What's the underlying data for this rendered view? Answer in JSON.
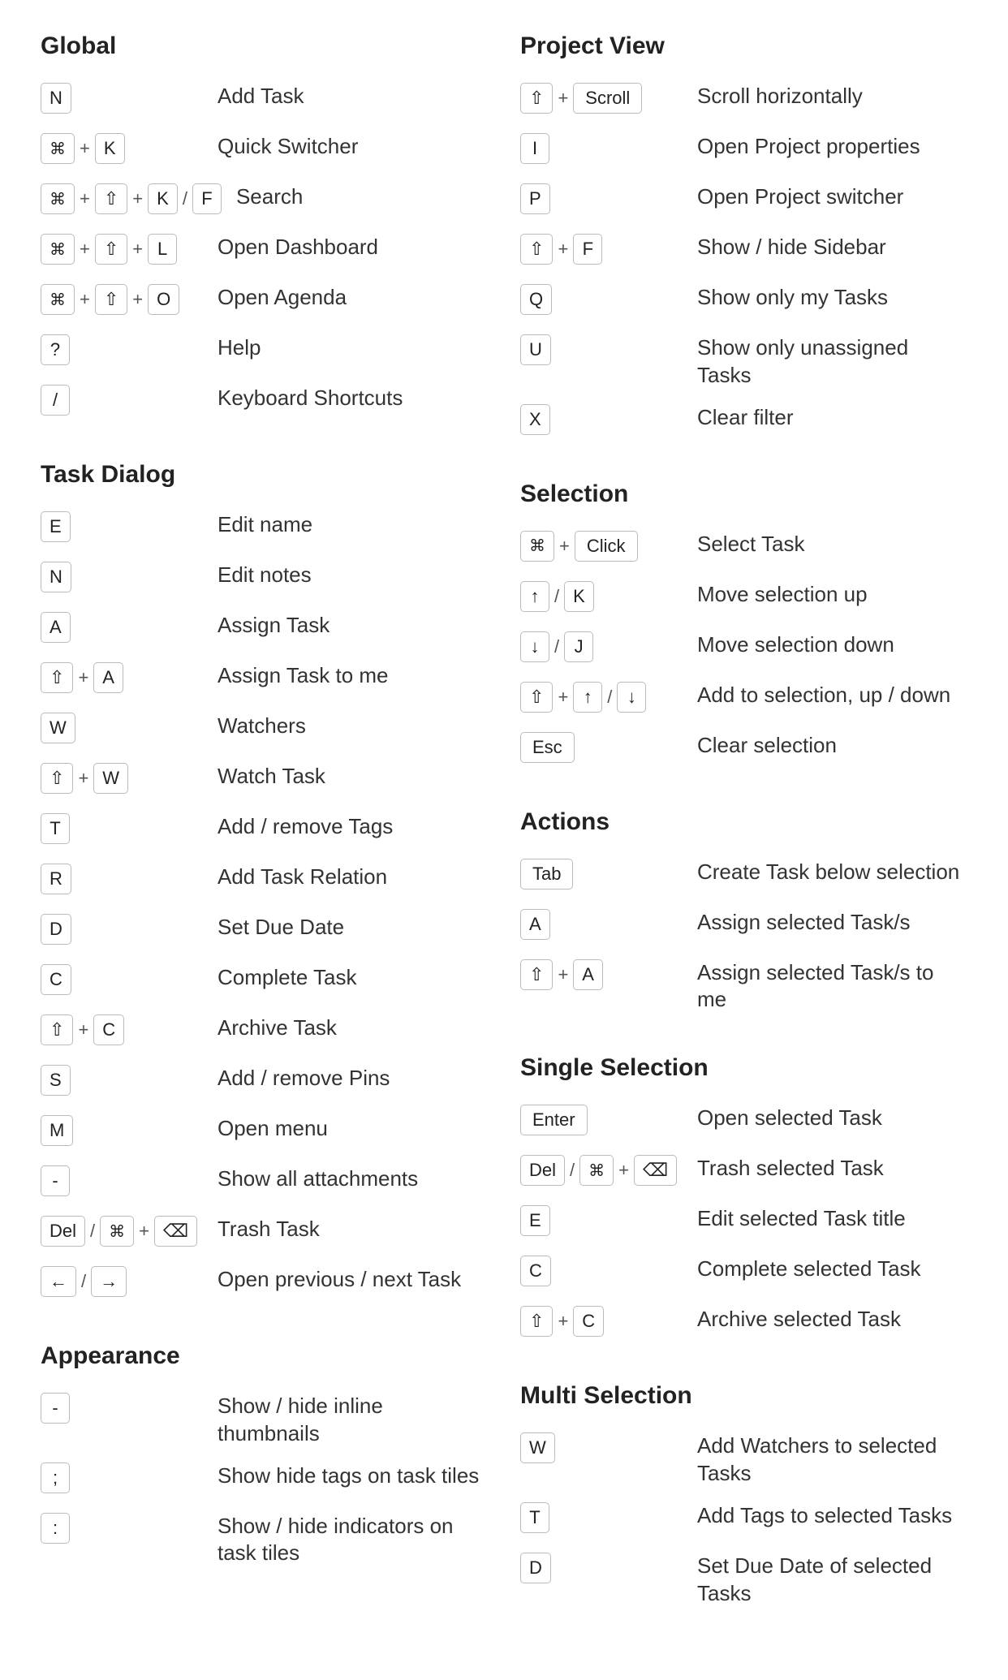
{
  "sections": {
    "global": {
      "title": "Global",
      "shortcuts": [
        {
          "keys": [
            {
              "type": "key",
              "label": "N"
            }
          ],
          "action": "Add Task"
        },
        {
          "keys": [
            {
              "type": "key",
              "label": "⌘",
              "cls": "cmd"
            },
            {
              "type": "sep",
              "label": "+"
            },
            {
              "type": "key",
              "label": "K"
            }
          ],
          "action": "Quick Switcher"
        },
        {
          "keys": [
            {
              "type": "key",
              "label": "⌘",
              "cls": "cmd"
            },
            {
              "type": "sep",
              "label": "+"
            },
            {
              "type": "key",
              "label": "⇧"
            },
            {
              "type": "sep",
              "label": "+"
            },
            {
              "type": "key",
              "label": "K"
            },
            {
              "type": "sep",
              "label": "/"
            },
            {
              "type": "key",
              "label": "F"
            }
          ],
          "action": "Search"
        },
        {
          "keys": [
            {
              "type": "key",
              "label": "⌘",
              "cls": "cmd"
            },
            {
              "type": "sep",
              "label": "+"
            },
            {
              "type": "key",
              "label": "⇧"
            },
            {
              "type": "sep",
              "label": "+"
            },
            {
              "type": "key",
              "label": "L"
            }
          ],
          "action": "Open Dashboard"
        },
        {
          "keys": [
            {
              "type": "key",
              "label": "⌘",
              "cls": "cmd"
            },
            {
              "type": "sep",
              "label": "+"
            },
            {
              "type": "key",
              "label": "⇧"
            },
            {
              "type": "sep",
              "label": "+"
            },
            {
              "type": "key",
              "label": "O"
            }
          ],
          "action": "Open Agenda"
        },
        {
          "keys": [
            {
              "type": "key",
              "label": "?"
            }
          ],
          "action": "Help"
        },
        {
          "keys": [
            {
              "type": "key",
              "label": "/"
            }
          ],
          "action": "Keyboard Shortcuts"
        }
      ]
    },
    "taskDialog": {
      "title": "Task Dialog",
      "shortcuts": [
        {
          "keys": [
            {
              "type": "key",
              "label": "E"
            }
          ],
          "action": "Edit name"
        },
        {
          "keys": [
            {
              "type": "key",
              "label": "N"
            }
          ],
          "action": "Edit notes"
        },
        {
          "keys": [
            {
              "type": "key",
              "label": "A"
            }
          ],
          "action": "Assign Task"
        },
        {
          "keys": [
            {
              "type": "key",
              "label": "⇧"
            },
            {
              "type": "sep",
              "label": "+"
            },
            {
              "type": "key",
              "label": "A"
            }
          ],
          "action": "Assign Task to me"
        },
        {
          "keys": [
            {
              "type": "key",
              "label": "W"
            }
          ],
          "action": "Watchers"
        },
        {
          "keys": [
            {
              "type": "key",
              "label": "⇧"
            },
            {
              "type": "sep",
              "label": "+"
            },
            {
              "type": "key",
              "label": "W"
            }
          ],
          "action": "Watch Task"
        },
        {
          "keys": [
            {
              "type": "key",
              "label": "T"
            }
          ],
          "action": "Add / remove Tags"
        },
        {
          "keys": [
            {
              "type": "key",
              "label": "R"
            }
          ],
          "action": "Add Task Relation"
        },
        {
          "keys": [
            {
              "type": "key",
              "label": "D"
            }
          ],
          "action": "Set Due Date"
        },
        {
          "keys": [
            {
              "type": "key",
              "label": "C"
            }
          ],
          "action": "Complete Task"
        },
        {
          "keys": [
            {
              "type": "key",
              "label": "⇧"
            },
            {
              "type": "sep",
              "label": "+"
            },
            {
              "type": "key",
              "label": "C"
            }
          ],
          "action": "Archive Task"
        },
        {
          "keys": [
            {
              "type": "key",
              "label": "S"
            }
          ],
          "action": "Add / remove Pins"
        },
        {
          "keys": [
            {
              "type": "key",
              "label": "M"
            }
          ],
          "action": "Open menu"
        },
        {
          "keys": [
            {
              "type": "key",
              "label": "-"
            }
          ],
          "action": "Show all attachments"
        },
        {
          "keys": [
            {
              "type": "key",
              "label": "Del"
            },
            {
              "type": "sep",
              "label": "/"
            },
            {
              "type": "key",
              "label": "⌘",
              "cls": "cmd"
            },
            {
              "type": "sep",
              "label": "+"
            },
            {
              "type": "key",
              "label": "⌫"
            }
          ],
          "action": "Trash Task"
        },
        {
          "keys": [
            {
              "type": "key",
              "label": "←"
            },
            {
              "type": "sep",
              "label": "/"
            },
            {
              "type": "key",
              "label": "→"
            }
          ],
          "action": "Open previous / next Task"
        }
      ]
    },
    "appearance": {
      "title": "Appearance",
      "shortcuts": [
        {
          "keys": [
            {
              "type": "key",
              "label": "-"
            }
          ],
          "action": "Show / hide inline thumbnails"
        },
        {
          "keys": [
            {
              "type": "key",
              "label": ";"
            }
          ],
          "action": "Show hide tags on task tiles"
        },
        {
          "keys": [
            {
              "type": "key",
              "label": ":"
            }
          ],
          "action": "Show / hide indicators on task tiles"
        }
      ]
    },
    "projectView": {
      "title": "Project View",
      "shortcuts": [
        {
          "keys": [
            {
              "type": "key",
              "label": "⇧"
            },
            {
              "type": "sep",
              "label": "+"
            },
            {
              "type": "key",
              "label": "Scroll",
              "cls": "wide"
            }
          ],
          "action": "Scroll horizontally"
        },
        {
          "keys": [
            {
              "type": "key",
              "label": "I"
            }
          ],
          "action": "Open Project properties"
        },
        {
          "keys": [
            {
              "type": "key",
              "label": "P"
            }
          ],
          "action": "Open Project switcher"
        },
        {
          "keys": [
            {
              "type": "key",
              "label": "⇧"
            },
            {
              "type": "sep",
              "label": "+"
            },
            {
              "type": "key",
              "label": "F"
            }
          ],
          "action": "Show / hide Sidebar"
        },
        {
          "keys": [
            {
              "type": "key",
              "label": "Q"
            }
          ],
          "action": "Show only my Tasks"
        },
        {
          "keys": [
            {
              "type": "key",
              "label": "U"
            }
          ],
          "action": "Show only unassigned Tasks"
        },
        {
          "keys": [
            {
              "type": "key",
              "label": "X"
            }
          ],
          "action": "Clear filter"
        }
      ]
    },
    "selection": {
      "title": "Selection",
      "shortcuts": [
        {
          "keys": [
            {
              "type": "key",
              "label": "⌘",
              "cls": "cmd"
            },
            {
              "type": "sep",
              "label": "+"
            },
            {
              "type": "key",
              "label": "Click",
              "cls": "wide"
            }
          ],
          "action": "Select Task"
        },
        {
          "keys": [
            {
              "type": "key",
              "label": "↑"
            },
            {
              "type": "sep",
              "label": "/"
            },
            {
              "type": "key",
              "label": "K"
            }
          ],
          "action": "Move selection up"
        },
        {
          "keys": [
            {
              "type": "key",
              "label": "↓"
            },
            {
              "type": "sep",
              "label": "/"
            },
            {
              "type": "key",
              "label": "J"
            }
          ],
          "action": "Move selection down"
        },
        {
          "keys": [
            {
              "type": "key",
              "label": "⇧"
            },
            {
              "type": "sep",
              "label": "+"
            },
            {
              "type": "key",
              "label": "↑"
            },
            {
              "type": "sep",
              "label": "/"
            },
            {
              "type": "key",
              "label": "↓"
            }
          ],
          "action": "Add to selection, up / down"
        },
        {
          "keys": [
            {
              "type": "key",
              "label": "Esc",
              "cls": "wide"
            }
          ],
          "action": "Clear selection"
        }
      ]
    },
    "actions": {
      "title": "Actions",
      "shortcuts": [
        {
          "keys": [
            {
              "type": "key",
              "label": "Tab",
              "cls": "wide"
            }
          ],
          "action": "Create Task below selection"
        },
        {
          "keys": [
            {
              "type": "key",
              "label": "A"
            }
          ],
          "action": "Assign selected Task/s"
        },
        {
          "keys": [
            {
              "type": "key",
              "label": "⇧"
            },
            {
              "type": "sep",
              "label": "+"
            },
            {
              "type": "key",
              "label": "A"
            }
          ],
          "action": "Assign selected Task/s to me"
        }
      ]
    },
    "singleSelection": {
      "title": "Single Selection",
      "shortcuts": [
        {
          "keys": [
            {
              "type": "key",
              "label": "Enter",
              "cls": "wide"
            }
          ],
          "action": "Open selected Task"
        },
        {
          "keys": [
            {
              "type": "key",
              "label": "Del"
            },
            {
              "type": "sep",
              "label": "/"
            },
            {
              "type": "key",
              "label": "⌘",
              "cls": "cmd"
            },
            {
              "type": "sep",
              "label": "+"
            },
            {
              "type": "key",
              "label": "⌫"
            }
          ],
          "action": "Trash selected Task"
        },
        {
          "keys": [
            {
              "type": "key",
              "label": "E"
            }
          ],
          "action": "Edit selected Task title"
        },
        {
          "keys": [
            {
              "type": "key",
              "label": "C"
            }
          ],
          "action": "Complete selected Task"
        },
        {
          "keys": [
            {
              "type": "key",
              "label": "⇧"
            },
            {
              "type": "sep",
              "label": "+"
            },
            {
              "type": "key",
              "label": "C"
            }
          ],
          "action": "Archive selected Task"
        }
      ]
    },
    "multiSelection": {
      "title": "Multi Selection",
      "shortcuts": [
        {
          "keys": [
            {
              "type": "key",
              "label": "W"
            }
          ],
          "action": "Add Watchers to selected Tasks"
        },
        {
          "keys": [
            {
              "type": "key",
              "label": "T"
            }
          ],
          "action": "Add Tags to selected Tasks"
        },
        {
          "keys": [
            {
              "type": "key",
              "label": "D"
            }
          ],
          "action": "Set Due Date of selected Tasks"
        }
      ]
    }
  }
}
